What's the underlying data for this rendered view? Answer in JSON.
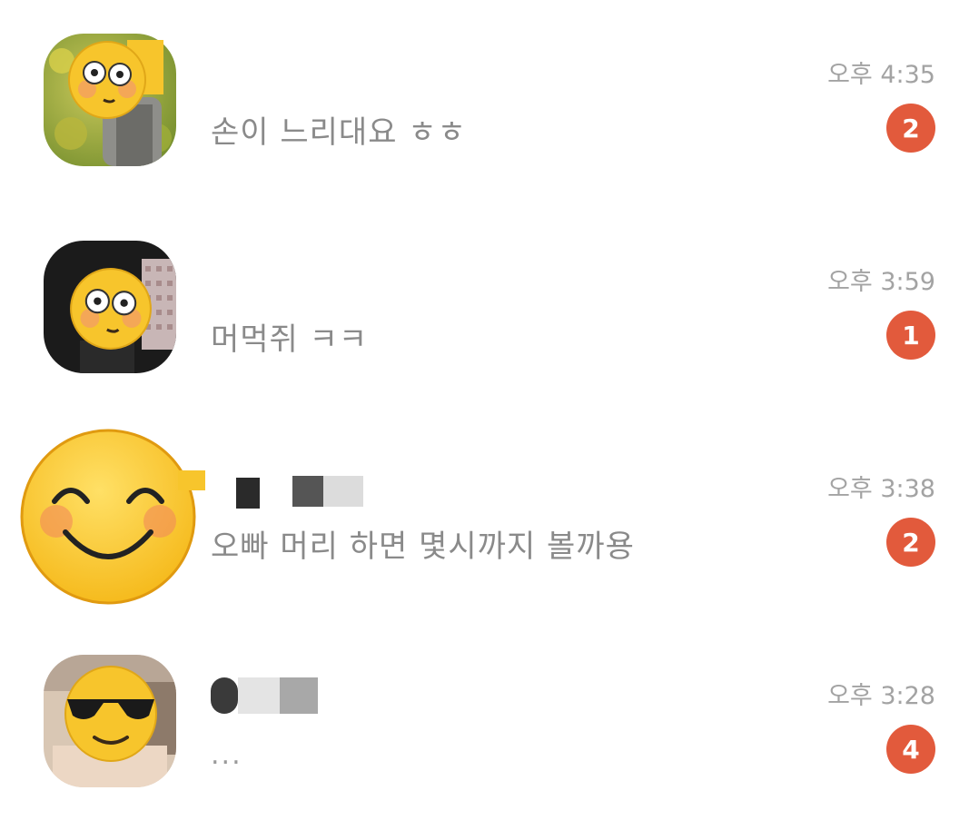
{
  "chats": [
    {
      "preview": "손이 느리대요 ㅎㅎ",
      "time": "오후 4:35",
      "unread": "2",
      "avatar_sticker": "flushed-face-icon"
    },
    {
      "preview": "머먹쥐 ㅋㅋ",
      "time": "오후 3:59",
      "unread": "1",
      "avatar_sticker": "flushed-face-icon"
    },
    {
      "preview": "오빠 머리 하면 몇시까지 볼까용",
      "time": "오후 3:38",
      "unread": "2",
      "avatar_sticker": "smiling-face-icon"
    },
    {
      "preview": "...",
      "time": "오후 3:28",
      "unread": "4",
      "avatar_sticker": "sunglasses-face-icon"
    }
  ],
  "colors": {
    "badge": "#e25a3c",
    "preview_text": "#8a8a8a",
    "time_text": "#a3a3a3",
    "emoji_yellow": "#f7c52c"
  }
}
